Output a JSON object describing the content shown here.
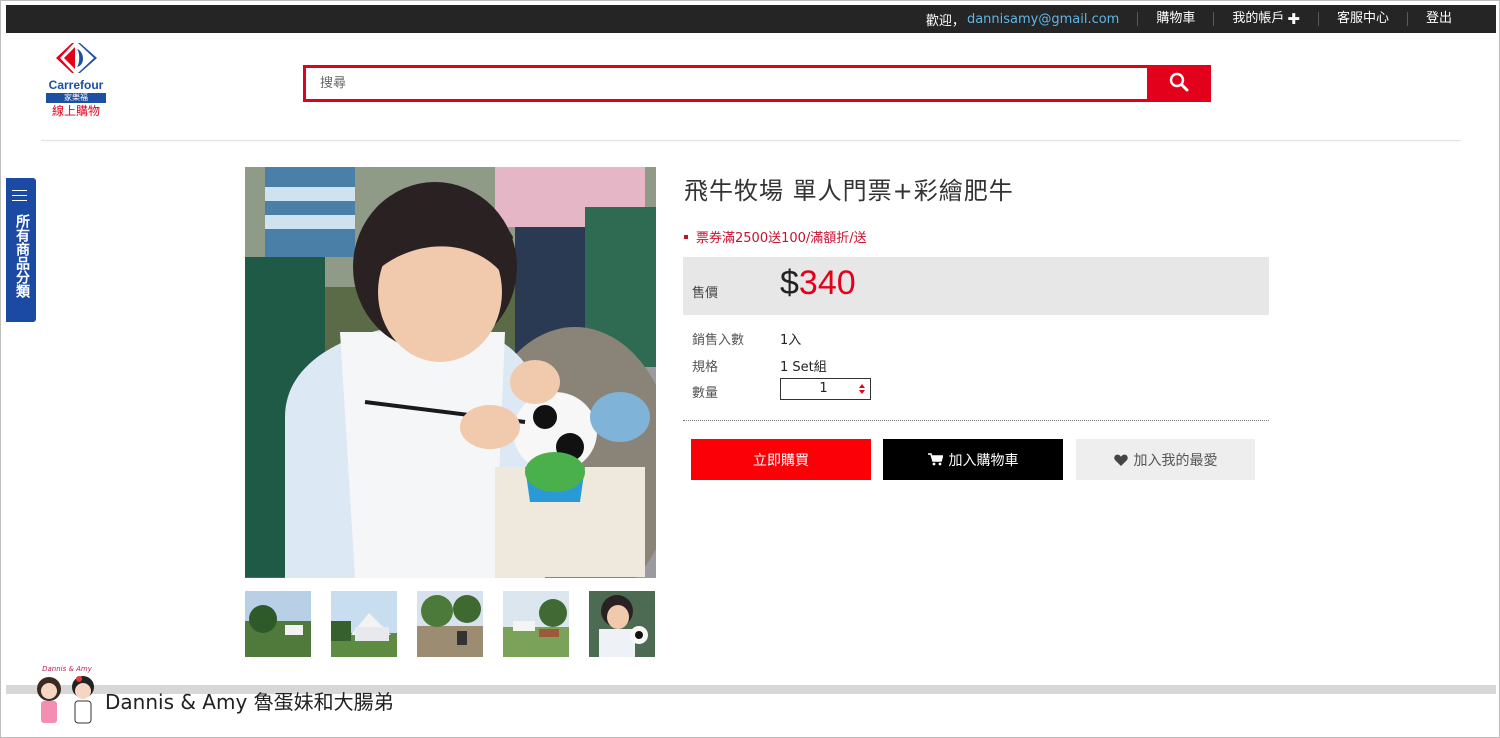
{
  "topbar": {
    "welcome_label": "歡迎，",
    "email": "dannisamy@gmail.com",
    "cart": "購物車",
    "account": "我的帳戶",
    "service": "客服中心",
    "logout": "登出"
  },
  "logo": {
    "brand": "Carrefour",
    "brand_cn": "家樂福",
    "online": "線上購物"
  },
  "search": {
    "placeholder": "搜尋"
  },
  "category_tab": {
    "label": "所有商品分類"
  },
  "product": {
    "title": "飛牛牧場 單人門票+彩繪肥牛",
    "promo": "票券滿2500送100/滿額折/送",
    "price_label": "售價",
    "currency": "$",
    "price": "340",
    "specs": [
      {
        "key": "銷售入數",
        "value": "1入"
      },
      {
        "key": "規格",
        "value": "1 Set組"
      },
      {
        "key": "數量",
        "value": ""
      }
    ],
    "quantity": "1"
  },
  "buttons": {
    "buy_now": "立即購買",
    "add_cart": "加入購物車",
    "add_fav": "加入我的最愛"
  },
  "watermark": {
    "logo_text": "Dannis & Amy",
    "text": "Dannis & Amy 魯蛋妹和大腸弟"
  },
  "colors": {
    "accent": "#e3001b",
    "topbar": "#252525",
    "brand_blue": "#1d4fa3"
  }
}
